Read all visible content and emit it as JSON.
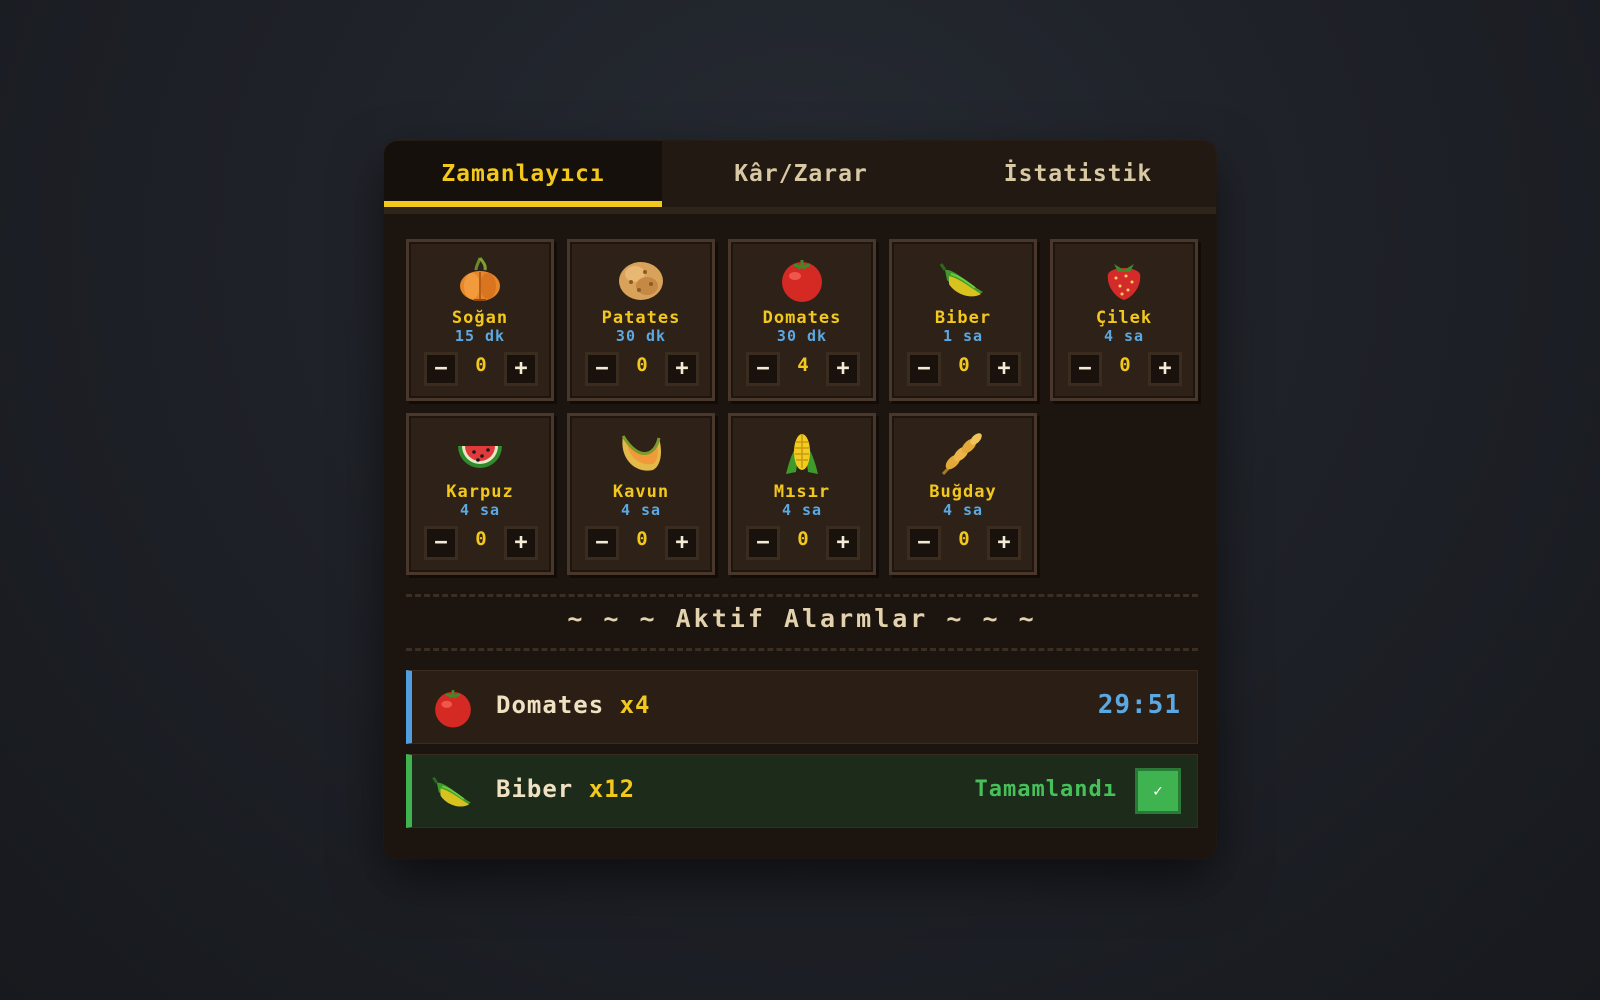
{
  "tabs": [
    {
      "label": "Zamanlayıcı",
      "active": true
    },
    {
      "label": "Kâr/Zarar",
      "active": false
    },
    {
      "label": "İstatistik",
      "active": false
    }
  ],
  "crops": [
    {
      "name": "Soğan",
      "duration": "15 dk",
      "count": "0",
      "icon": "onion-icon"
    },
    {
      "name": "Patates",
      "duration": "30 dk",
      "count": "0",
      "icon": "potato-icon"
    },
    {
      "name": "Domates",
      "duration": "30 dk",
      "count": "4",
      "icon": "tomato-icon"
    },
    {
      "name": "Biber",
      "duration": "1 sa",
      "count": "0",
      "icon": "pepper-icon"
    },
    {
      "name": "Çilek",
      "duration": "4 sa",
      "count": "0",
      "icon": "strawberry-icon"
    },
    {
      "name": "Karpuz",
      "duration": "4 sa",
      "count": "0",
      "icon": "watermelon-icon"
    },
    {
      "name": "Kavun",
      "duration": "4 sa",
      "count": "0",
      "icon": "melon-icon"
    },
    {
      "name": "Mısır",
      "duration": "4 sa",
      "count": "0",
      "icon": "corn-icon"
    },
    {
      "name": "Buğday",
      "duration": "4 sa",
      "count": "0",
      "icon": "wheat-icon"
    }
  ],
  "stepper": {
    "minus": "−",
    "plus": "+"
  },
  "alarms_title": "~ ~ ~ Aktif Alarmlar ~ ~ ~",
  "alarms": [
    {
      "name": "Domates",
      "qty": "x4",
      "timer": "29:51",
      "icon": "tomato-icon",
      "state": "active"
    },
    {
      "name": "Biber",
      "qty": "x12",
      "status": "Tamamlandı",
      "check": "✓",
      "icon": "pepper-icon",
      "state": "done"
    }
  ],
  "colors": {
    "accent": "#f3c81c",
    "timer": "#5ba9e3",
    "done": "#3fb350",
    "panel": "#1c140e",
    "card": "#2e2117"
  }
}
